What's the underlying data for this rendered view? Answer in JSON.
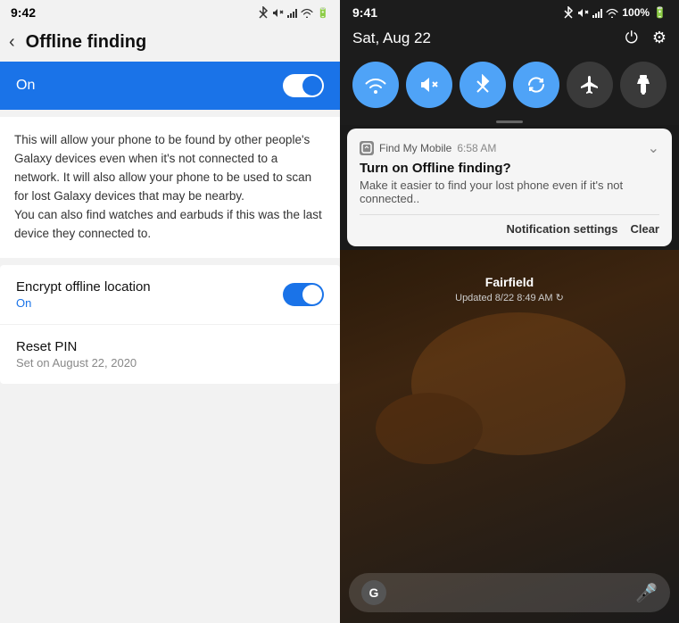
{
  "left": {
    "status_time": "9:42",
    "header_title": "Offline finding",
    "toggle_label": "On",
    "description": "This will allow your phone to be found by other people's Galaxy devices even when it's not connected to a network. It will also allow your phone to be used to scan for lost Galaxy devices that may be nearby.\nYou can also find watches and earbuds if this was the last device they connected to.",
    "encrypt_title": "Encrypt offline location",
    "encrypt_status": "On",
    "reset_title": "Reset PIN",
    "reset_subtitle": "Set on August 22, 2020"
  },
  "right": {
    "status_time": "9:41",
    "battery": "100%",
    "date": "Sat, Aug 22",
    "notification": {
      "app_name": "Find My Mobile",
      "time": "6:58 AM",
      "title": "Turn on Offline finding?",
      "body": "Make it easier to find your lost phone even if it's not connected..",
      "action1": "Notification settings",
      "action2": "Clear"
    },
    "map": {
      "location": "Fairfield",
      "updated": "Updated 8/22 8:49 AM"
    }
  }
}
